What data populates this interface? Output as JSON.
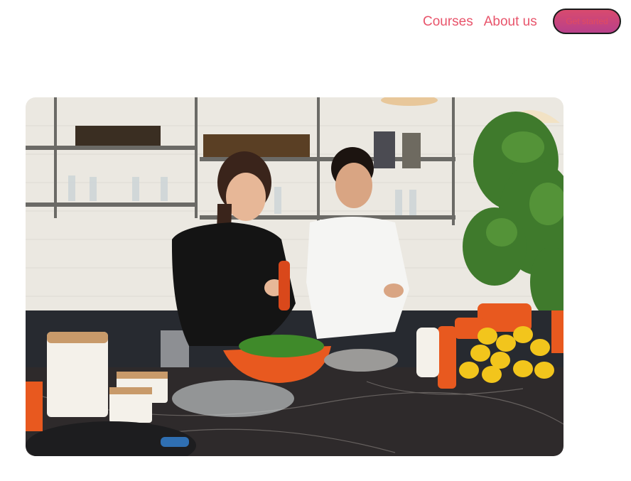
{
  "nav": {
    "links": [
      {
        "label": "Courses"
      },
      {
        "label": "About us"
      }
    ],
    "cta_label": "Get started"
  },
  "hero": {
    "image_description": "Two people cooking together in a bright kitchen with shelves, plants, lemons and orange cookware",
    "colors": {
      "wall": "#eceae4",
      "counter": "#2d2a2b",
      "cookware": "#e8591f",
      "lemon": "#f2c51c",
      "plant": "#3f7a2c"
    }
  },
  "brand": {
    "accent": "#e8546b"
  }
}
